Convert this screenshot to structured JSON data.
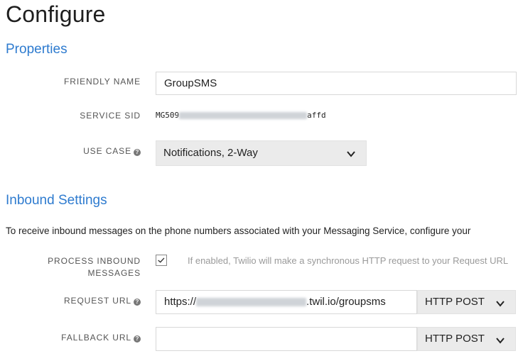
{
  "page": {
    "title": "Configure"
  },
  "properties": {
    "title": "Properties",
    "friendly_name": {
      "label": "FRIENDLY NAME",
      "value": "GroupSMS"
    },
    "service_sid": {
      "label": "SERVICE SID",
      "prefix": "MG509",
      "suffix": "affd"
    },
    "use_case": {
      "label": "USE CASE",
      "value": "Notifications, 2-Way"
    }
  },
  "inbound": {
    "title": "Inbound Settings",
    "intro": "To receive inbound messages on the phone numbers associated with your Messaging Service, configure your",
    "process_inbound": {
      "label_line1": "PROCESS INBOUND",
      "label_line2": "MESSAGES",
      "checked": true,
      "hint": "If enabled, Twilio will make a synchronous HTTP request to your Request URL"
    },
    "request_url": {
      "label": "REQUEST URL",
      "prefix": "https://",
      "suffix": ".twil.io/groupsms",
      "method": "HTTP POST"
    },
    "fallback_url": {
      "label": "FALLBACK URL",
      "value": "",
      "method": "HTTP POST"
    }
  },
  "icons": {
    "help": "question-circle-icon",
    "chevron": "chevron-down-icon",
    "check": "check-icon"
  },
  "colors": {
    "accent": "#2e7bcf",
    "select_bg": "#ebebeb"
  }
}
